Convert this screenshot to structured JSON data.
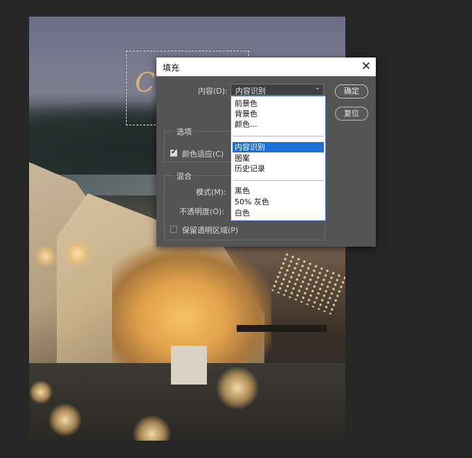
{
  "dialog": {
    "title": "填充",
    "close_glyph": "✕",
    "content_label": "内容(D):",
    "content_value": "内容识别",
    "ok_label": "确定",
    "reset_label": "复位",
    "options_group_title": "选项",
    "color_adapt_label": "颜色适应(C)",
    "color_adapt_checked": true,
    "blend_group_title": "混合",
    "mode_label": "模式(M):",
    "opacity_label": "不透明度(O):",
    "preserve_transparency_label": "保留透明区域(P)",
    "preserve_transparency_checked": false
  },
  "dropdown": {
    "items": [
      "前景色",
      "背景色",
      "颜色...",
      "内容识别",
      "图案",
      "历史记录",
      "黑色",
      "50% 灰色",
      "白色"
    ],
    "selected": "内容识别"
  },
  "colors": {
    "app_background": "#262626",
    "dialog_background": "#545454",
    "selection_highlight": "#1e6fd6"
  }
}
